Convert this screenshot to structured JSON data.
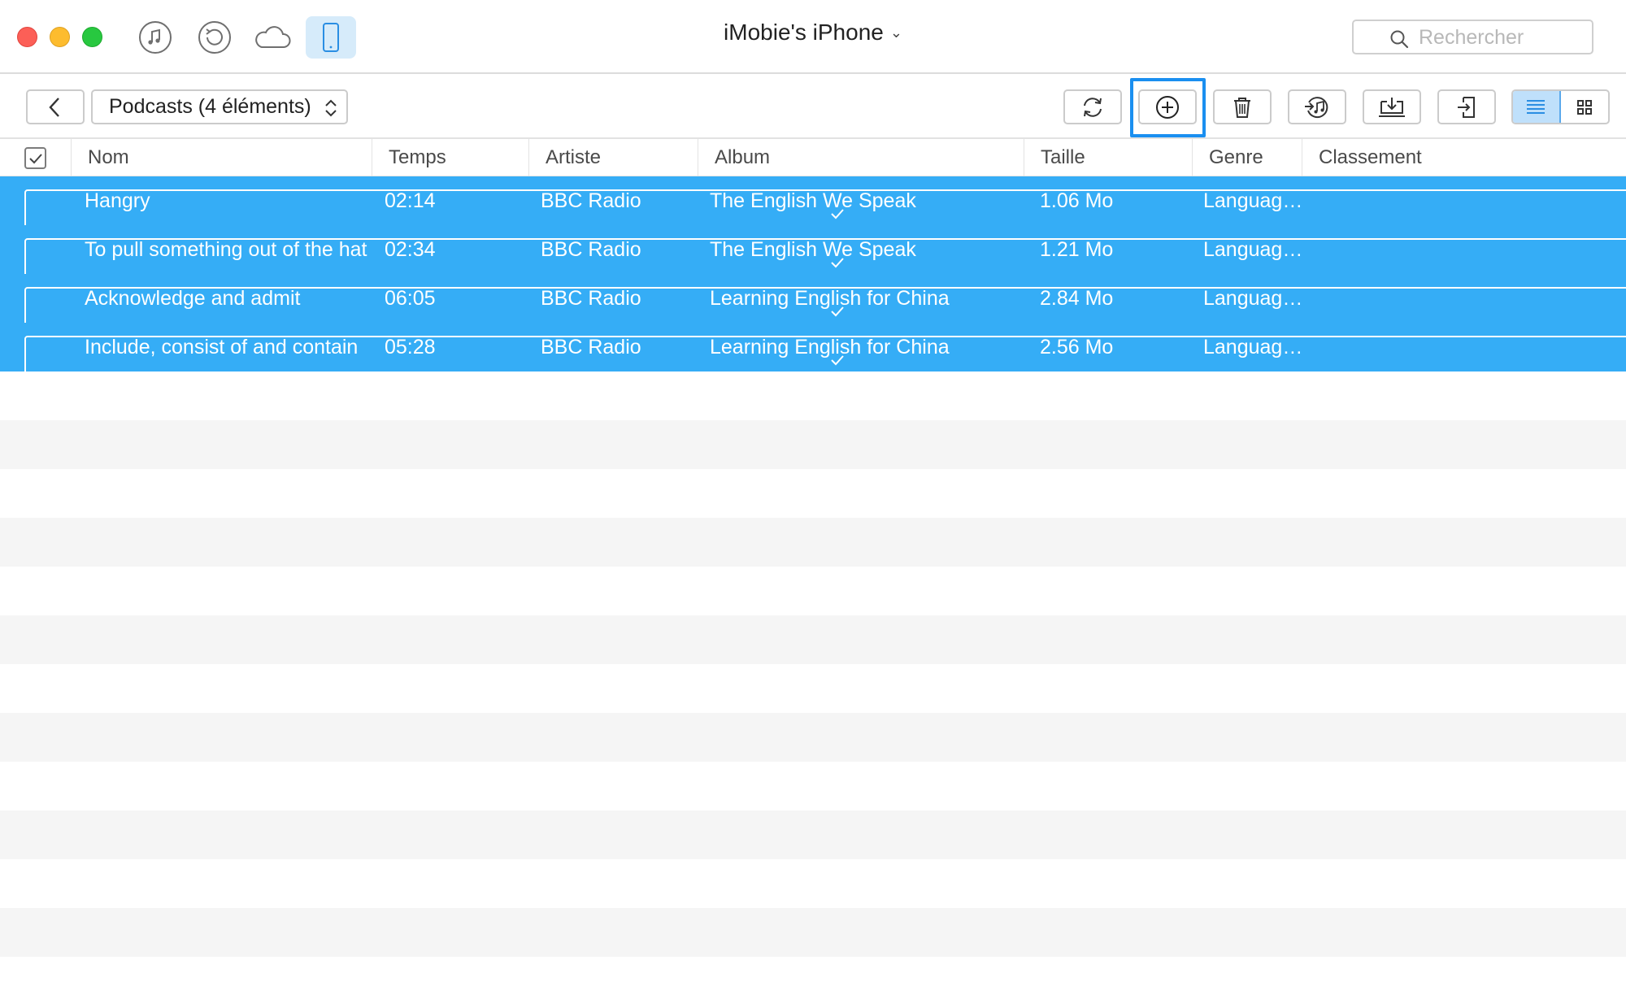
{
  "window": {
    "device_name": "iMobie's iPhone",
    "device_chevron": "⌄"
  },
  "nav": {
    "icons": [
      "music-icon",
      "restore-icon",
      "cloud-icon",
      "phone-icon"
    ],
    "active": "phone-icon"
  },
  "search": {
    "placeholder": "Rechercher",
    "value": ""
  },
  "toolbar": {
    "category_label": "Podcasts (4 éléments)",
    "buttons": [
      "refresh-icon",
      "add-icon",
      "delete-icon",
      "music-transfer-icon",
      "export-to-computer-icon",
      "send-to-device-icon"
    ],
    "highlighted_button": "add-icon",
    "view_mode": "list"
  },
  "table": {
    "columns": [
      "Nom",
      "Temps",
      "Artiste",
      "Album",
      "Taille",
      "Genre",
      "Classement"
    ],
    "rows": [
      {
        "name": "Hangry",
        "time": "02:14",
        "artist": "BBC Radio",
        "album": "The English We Speak",
        "size": "1.06 Mo",
        "genre": "Languag…",
        "rating": "",
        "checked": true
      },
      {
        "name": "To pull something out of the hat",
        "time": "02:34",
        "artist": "BBC Radio",
        "album": "The English We Speak",
        "size": "1.21 Mo",
        "genre": "Languag…",
        "rating": "",
        "checked": true
      },
      {
        "name": "Acknowledge and admit",
        "time": "06:05",
        "artist": "BBC Radio",
        "album": "Learning English for China",
        "size": "2.84 Mo",
        "genre": "Languag…",
        "rating": "",
        "checked": true
      },
      {
        "name": "Include, consist of and contain",
        "time": "05:28",
        "artist": "BBC Radio",
        "album": "Learning English for China",
        "size": "2.56 Mo",
        "genre": "Languag…",
        "rating": "",
        "checked": true
      }
    ]
  },
  "colors": {
    "selection": "#35adf6",
    "accent": "#1a8ff0",
    "active_nav_bg": "#d6ebfa",
    "stripe": "#f5f5f5"
  }
}
